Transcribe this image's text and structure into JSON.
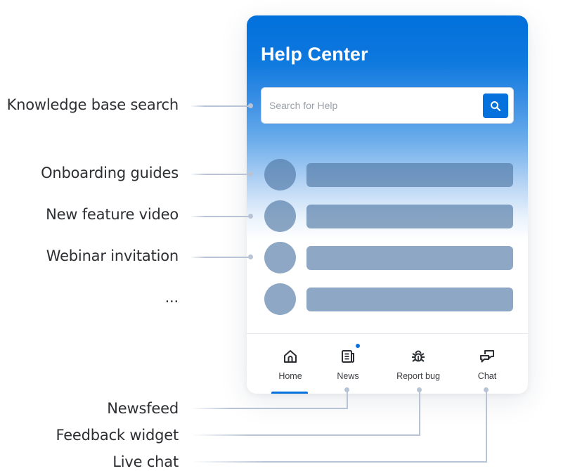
{
  "annotations": {
    "search": "Knowledge base search",
    "onboarding": "Onboarding guides",
    "feature_video": "New feature video",
    "webinar": "Webinar invitation",
    "more": "...",
    "newsfeed": "Newsfeed",
    "feedback": "Feedback widget",
    "live_chat": "Live chat"
  },
  "widget": {
    "title": "Help Center",
    "search": {
      "placeholder": "Search for Help",
      "value": "",
      "button_icon": "search-icon"
    },
    "list_items": [
      {
        "kind": "placeholder"
      },
      {
        "kind": "placeholder"
      },
      {
        "kind": "placeholder"
      },
      {
        "kind": "placeholder"
      }
    ],
    "nav": {
      "active": "Home",
      "items": [
        {
          "label": "Home",
          "icon": "home-icon"
        },
        {
          "label": "News",
          "icon": "newspaper-icon",
          "has_badge": true
        },
        {
          "label": "Report bug",
          "icon": "bug-icon"
        },
        {
          "label": "Chat",
          "icon": "chat-icon"
        }
      ]
    }
  },
  "colors": {
    "accent": "#0571dc",
    "header_top": "#0270db",
    "placeholder_block": "#8aa7c4",
    "connector": "#b8c4d6",
    "label_text": "#2d2f33"
  }
}
